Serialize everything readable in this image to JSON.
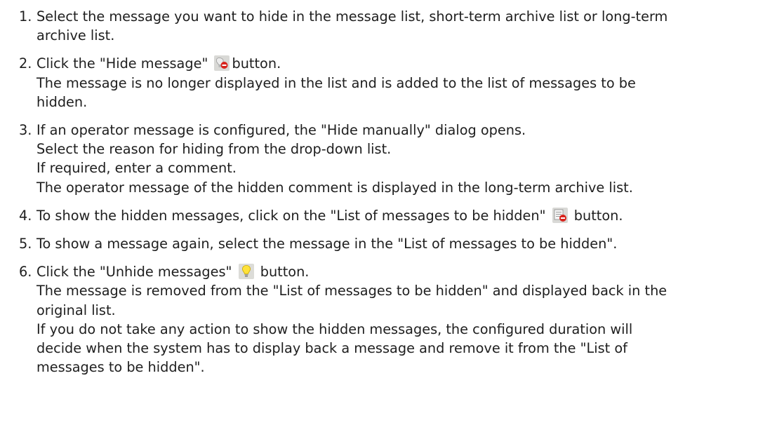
{
  "steps": [
    {
      "num": "1.",
      "l1": "Select the message you want to hide in the message list, short-term archive list or long-term",
      "l2": "archive list."
    },
    {
      "num": "2.",
      "l1a": "Click the \"Hide message\"",
      "l1b": "button.",
      "l2": "The message is no longer displayed in the list and is added to the list of messages to be",
      "l3": "hidden.",
      "icon": "hide-message-icon"
    },
    {
      "num": "3.",
      "l1": "If an operator message is configured, the \"Hide manually\" dialog opens.",
      "l2": "Select the reason for hiding from the drop-down list.",
      "l3": "If required, enter a comment.",
      "l4": "The operator message of the hidden comment is displayed in the long-term archive list."
    },
    {
      "num": "4.",
      "l1a": "To show the hidden messages, click on the \"List of messages to be hidden\"",
      "l1b": "button.",
      "icon": "list-of-hidden-messages-icon"
    },
    {
      "num": "5.",
      "l1": "To show a message again, select the message in the \"List of messages to be hidden\"."
    },
    {
      "num": "6.",
      "l1a": "Click the \"Unhide messages\"",
      "l1b": "button.",
      "l2": "The message is removed from the \"List of messages to be hidden\" and displayed back in the",
      "l3": "original list.",
      "l4": "If you do not take any action to show the hidden messages, the configured duration will",
      "l5": "decide when the system has to display back a message and remove it from the \"List of",
      "l6": "messages to be hidden\".",
      "icon": "unhide-messages-icon"
    }
  ]
}
